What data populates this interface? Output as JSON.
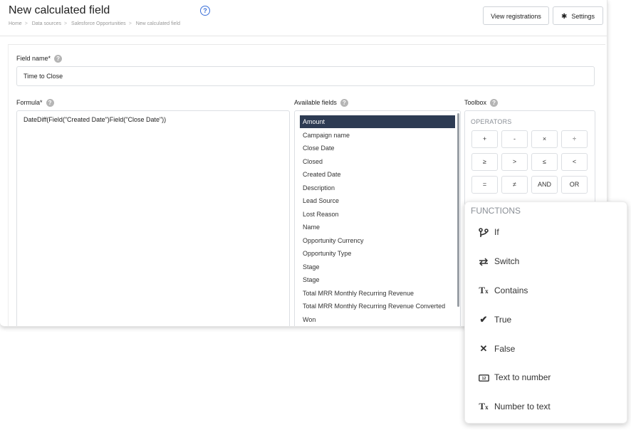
{
  "header": {
    "title": "New calculated field",
    "breadcrumb": [
      "Home",
      "Data sources",
      "Salesforce Opportunities",
      "New calculated field"
    ],
    "view_registrations_label": "View registrations",
    "settings_label": "Settings"
  },
  "field_name": {
    "label": "Field name*",
    "value": "Time to Close"
  },
  "formula": {
    "label": "Formula*",
    "value": "DateDiff(Field(\"Created Date\")Field(\"Close Date\"))"
  },
  "available_fields": {
    "label": "Available fields",
    "selected": "Amount",
    "items": [
      "Amount",
      "Campaign name",
      "Close Date",
      "Closed",
      "Created Date",
      "Description",
      "Lead Source",
      "Lost Reason",
      "Name",
      "Opportunity Currency",
      "Opportunity Type",
      "Stage",
      "Stage",
      "Total MRR Monthly Recurring Revenue",
      "Total MRR Monthly Recurring Revenue Converted",
      "Won"
    ]
  },
  "toolbox": {
    "label": "Toolbox",
    "operators_title": "OPERATORS",
    "operators": [
      "+",
      "-",
      "×",
      "÷",
      "≥",
      ">",
      "≤",
      "<",
      "=",
      "≠",
      "AND",
      "OR"
    ]
  },
  "functions": {
    "title": "FUNCTIONS",
    "items": [
      {
        "label": "If",
        "icon": "branch-icon"
      },
      {
        "label": "Switch",
        "icon": "switch-arrows-icon"
      },
      {
        "label": "Contains",
        "icon": "clear-format-icon"
      },
      {
        "label": "True",
        "icon": "check-icon"
      },
      {
        "label": "False",
        "icon": "x-icon"
      },
      {
        "label": "Text to number",
        "icon": "number-badge-icon"
      },
      {
        "label": "Number to text",
        "icon": "clear-format-icon"
      }
    ]
  },
  "colors": {
    "accent": "#3a6fd8",
    "selected_bg": "#2d3b53"
  }
}
